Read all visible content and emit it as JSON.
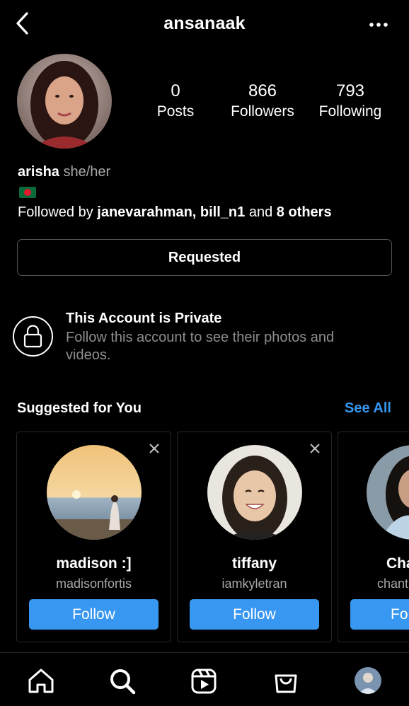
{
  "header": {
    "username": "ansanaak",
    "back_icon": "chevron-left-icon",
    "more_icon": "more-horizontal-icon"
  },
  "profile": {
    "stats": [
      {
        "value": "0",
        "label": "Posts"
      },
      {
        "value": "866",
        "label": "Followers"
      },
      {
        "value": "793",
        "label": "Following"
      }
    ],
    "display_name": "arisha",
    "pronouns": "she/her",
    "bio_emoji": "flag-bangladesh",
    "followed_by_prefix": "Followed by",
    "followed_by_names": "janevarahman, bill_n1",
    "followed_by_and": "and",
    "followed_by_others": "8 others"
  },
  "requested_button": {
    "label": "Requested"
  },
  "private_notice": {
    "title": "This Account is Private",
    "description": "Follow this account to see their photos and videos."
  },
  "suggested": {
    "title": "Suggested for You",
    "see_all": "See All",
    "cards": [
      {
        "name": "madison :]",
        "handle": "madisonfortis",
        "button": "Follow"
      },
      {
        "name": "tiffany",
        "handle": "iamkyletran",
        "button": "Follow"
      },
      {
        "name": "Cha",
        "handle": "chant",
        "button": "Fo"
      }
    ]
  },
  "bottom_nav": {
    "items": [
      "home-icon",
      "search-icon",
      "reels-icon",
      "shop-icon",
      "profile-avatar"
    ]
  },
  "colors": {
    "background": "#000000",
    "accent_blue": "#3797f0",
    "secondary_text": "#a8a8a8",
    "border": "#262626"
  }
}
